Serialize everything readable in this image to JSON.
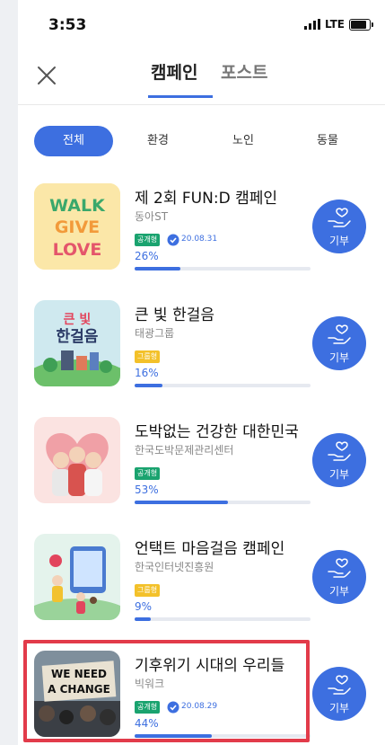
{
  "status_bar": {
    "time": "3:53",
    "network": "LTE"
  },
  "header": {
    "tabs": [
      {
        "label": "캠페인",
        "active": true
      },
      {
        "label": "포스트",
        "active": false
      }
    ]
  },
  "filters": [
    {
      "label": "전체",
      "active": true
    },
    {
      "label": "환경"
    },
    {
      "label": "노인"
    },
    {
      "label": "동물"
    }
  ],
  "campaigns": [
    {
      "title": "제 2회 FUN:D 캠페인",
      "org": "동아ST",
      "badge": "공개형",
      "badge_color": "#1aa36f",
      "verified": true,
      "date": "20.08.31",
      "progress": 26,
      "progress_label": "26%",
      "donate_label": "기부",
      "thumb_text": [
        "WALK",
        "GIVE",
        "LOVE"
      ]
    },
    {
      "title": "큰 빛 한걸음",
      "org": "태광그룹",
      "badge": "그룹형",
      "badge_color": "#f3c12a",
      "verified": false,
      "date": "",
      "progress": 16,
      "progress_label": "16%",
      "donate_label": "기부",
      "thumb_text": [
        "큰 빛",
        "한걸음"
      ]
    },
    {
      "title": "도박없는 건강한 대한민국",
      "org": "한국도박문제관리센터",
      "badge": "공개형",
      "badge_color": "#1aa36f",
      "verified": false,
      "date": "",
      "progress": 53,
      "progress_label": "53%",
      "donate_label": "기부"
    },
    {
      "title": "언택트 마음걸음 캠페인",
      "org": "한국인터넷진흥원",
      "badge": "그룹형",
      "badge_color": "#f3c12a",
      "verified": false,
      "date": "",
      "progress": 9,
      "progress_label": "9%",
      "donate_label": "기부"
    },
    {
      "title": "기후위기 시대의 우리들",
      "org": "빅워크",
      "badge": "공개형",
      "badge_color": "#1aa36f",
      "verified": true,
      "date": "20.08.29",
      "progress": 44,
      "progress_label": "44%",
      "donate_label": "기부",
      "thumb_text": [
        "WE NEED",
        "A CHANGE"
      ]
    }
  ],
  "accent_color": "#3d6fe0",
  "highlight_color": "#e23b4a"
}
